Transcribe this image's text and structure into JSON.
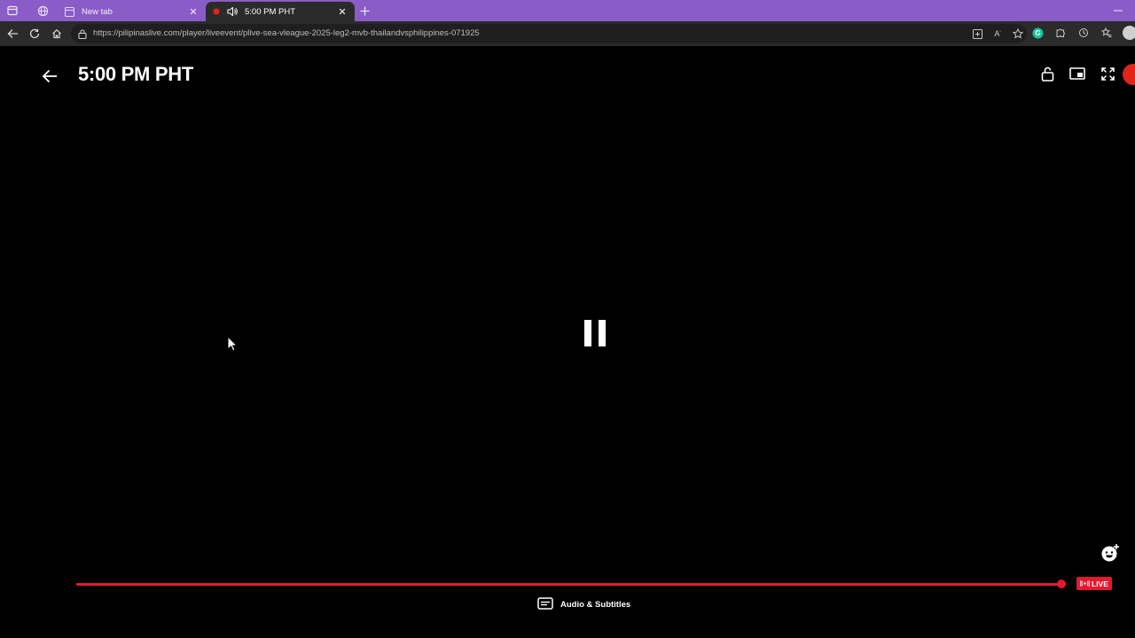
{
  "browser": {
    "tabs": [
      {
        "title": "New tab",
        "active": false
      },
      {
        "title": "5:00 PM PHT",
        "active": true
      }
    ],
    "url": "https://pilipinaslive.com/player/liveevent/plive-sea-vleague-2025-leg2-mvb-thailandvsphilippines-071925",
    "accent_color": "#8a5cc7"
  },
  "player": {
    "title": "5:00 PM PHT",
    "live_label": "LIVE",
    "subtitles_label": "Audio & Subtitles",
    "progress_percent": 99.6,
    "accent_color": "#e5192f"
  }
}
